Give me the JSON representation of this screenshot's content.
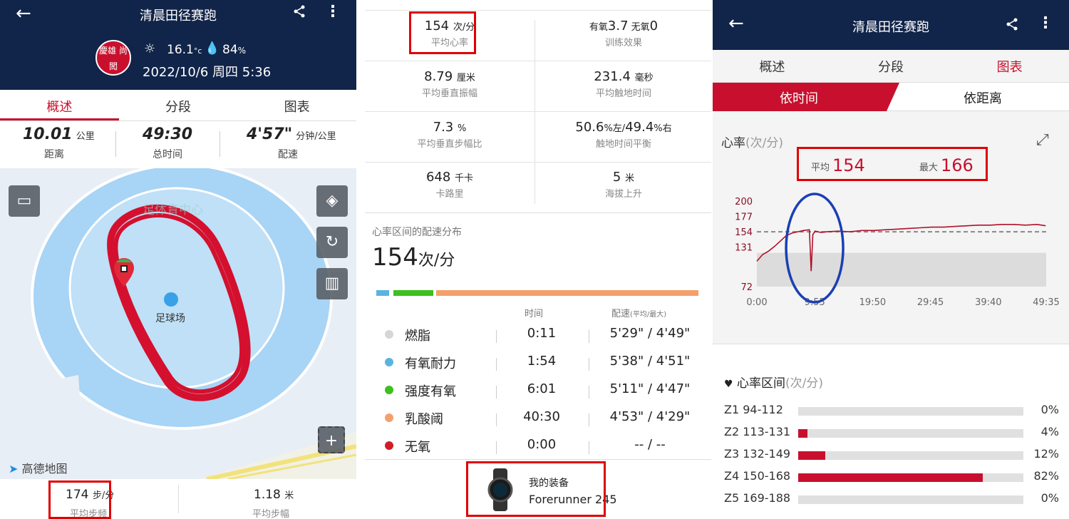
{
  "panel1": {
    "header": {
      "title": "清晨田径赛跑",
      "temp": "16.1",
      "temp_unit": "°c",
      "humidity": "84",
      "humidity_unit": "%",
      "datetime": "2022/10/6 周四 5:36",
      "logo_text": "慶雄 尚闖"
    },
    "tabs": [
      "概述",
      "分段",
      "图表"
    ],
    "stats": [
      {
        "value": "10.01",
        "unit": "公里",
        "label": "距离"
      },
      {
        "value": "49:30",
        "unit": "",
        "label": "总时间"
      },
      {
        "value": "4'57\"",
        "unit": "分钟/公里",
        "label": "配速"
      }
    ],
    "map": {
      "place_label": "足球场",
      "watermark": "足体育中心",
      "provider": "高德地图",
      "track_color": "#d4102e"
    },
    "bottom": [
      {
        "value": "174",
        "unit": "步/分",
        "label": "平均步频"
      },
      {
        "value": "1.18",
        "unit": "米",
        "label": "平均步幅"
      }
    ]
  },
  "panel2": {
    "metrics": [
      [
        {
          "value": "154",
          "unit": "次/分",
          "label": "平均心率"
        },
        {
          "pre": "有氧",
          "value": "3.7",
          "mid": " 无氧",
          "value2": "0",
          "label": "训练效果"
        }
      ],
      [
        {
          "value": "8.79",
          "unit": "厘米",
          "label": "平均垂直振幅"
        },
        {
          "value": "231.4",
          "unit": "毫秒",
          "label": "平均触地时间"
        }
      ],
      [
        {
          "value": "7.3",
          "unit": "%",
          "label": "平均垂直步幅比"
        },
        {
          "value": "50.6",
          "unit": "%左/",
          "value2": "49.4",
          "unit2": "%右",
          "label": "触地时间平衡"
        }
      ],
      [
        {
          "value": "648",
          "unit": "千卡",
          "label": "卡路里"
        },
        {
          "value": "5",
          "unit": "米",
          "label": "海拔上升"
        }
      ]
    ],
    "hr_section_title": "心率区间的配速分布",
    "hr_big": "154",
    "hr_big_unit": "次/分",
    "col_time": "时间",
    "col_pace": "配速",
    "col_pace_sub": "(平均/最大)",
    "zones": [
      {
        "name": "燃脂",
        "time": "0:11",
        "pace": "5'29\" / 4'49\"",
        "color": "#d6d6d6"
      },
      {
        "name": "有氧耐力",
        "time": "1:54",
        "pace": "5'38\" / 4'51\"",
        "color": "#5ab4e0"
      },
      {
        "name": "强度有氧",
        "time": "6:01",
        "pace": "5'11\" / 4'47\"",
        "color": "#3cc01e"
      },
      {
        "name": "乳酸阈",
        "time": "40:30",
        "pace": "4'53\" / 4'29\"",
        "color": "#f4a06a"
      },
      {
        "name": "无氧",
        "time": "0:00",
        "pace": "-- / --",
        "color": "#d01e24"
      }
    ],
    "zone_bar": [
      0.4,
      12,
      98
    ],
    "device_label": "我的装备",
    "device_name": "Forerunner 245"
  },
  "panel3": {
    "header": {
      "title": "清晨田径赛跑"
    },
    "tabs": [
      "概述",
      "分段",
      "图表"
    ],
    "subtabs": [
      "依时间",
      "依距离"
    ],
    "chart_title": "心率",
    "chart_unit": "(次/分)",
    "avg_label": "平均",
    "avg": "154",
    "max_label": "最大",
    "max": "166",
    "zones_title": "心率区间",
    "zones_unit": "(次/分)",
    "hr_zones": [
      {
        "name": "Z1",
        "range": "94-112",
        "pct": 0,
        "pct_label": "0%"
      },
      {
        "name": "Z2",
        "range": "113-131",
        "pct": 4,
        "pct_label": "4%"
      },
      {
        "name": "Z3",
        "range": "132-149",
        "pct": 12,
        "pct_label": "12%"
      },
      {
        "name": "Z4",
        "range": "150-168",
        "pct": 82,
        "pct_label": "82%"
      },
      {
        "name": "Z5",
        "range": "169-188",
        "pct": 0,
        "pct_label": "0%"
      }
    ]
  },
  "chart_data": {
    "type": "line",
    "title": "心率(次/分)",
    "ylabel": "",
    "xlabel": "",
    "yticks": [
      200,
      177,
      154,
      131,
      72
    ],
    "ylim": [
      72,
      200
    ],
    "xticks": [
      "0:00",
      "9:55",
      "19:50",
      "29:45",
      "39:40",
      "49:35"
    ],
    "avg_line": 154,
    "series": [
      {
        "values_x_min": [
          0,
          1,
          2,
          3,
          4,
          5,
          6,
          7,
          8,
          9,
          9.3,
          9.6,
          10,
          11,
          12,
          14,
          16,
          18,
          20,
          22,
          24,
          26,
          28,
          30,
          32,
          34,
          36,
          38,
          40,
          42,
          44,
          46,
          48,
          49.5
        ],
        "values": [
          110,
          120,
          125,
          132,
          140,
          148,
          152,
          154,
          156,
          157,
          95,
          150,
          155,
          153,
          154,
          155,
          154,
          156,
          156,
          157,
          158,
          159,
          160,
          161,
          161,
          162,
          163,
          164,
          164,
          165,
          165,
          164,
          165,
          163
        ]
      }
    ]
  }
}
